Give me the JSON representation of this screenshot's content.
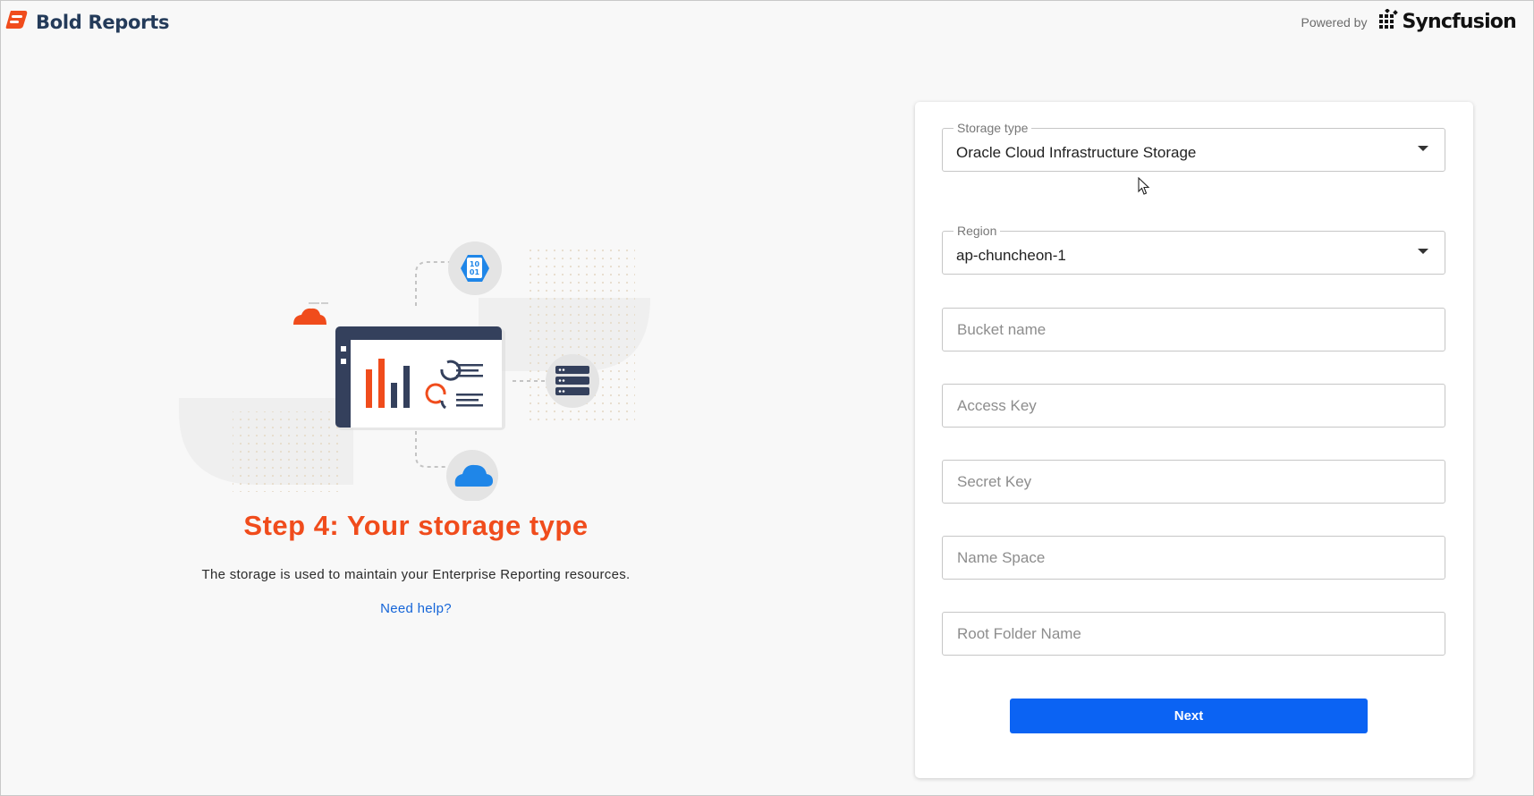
{
  "header": {
    "brand_name": "Bold Reports",
    "brand_color": "#f04c1c",
    "powered_by_label": "Powered by",
    "partner_logo_text": "Syncfusion"
  },
  "intro": {
    "title": "Step 4: Your storage type",
    "description": "The storage is used to maintain your Enterprise Reporting resources.",
    "help_link": "Need help?",
    "illustration_icons": [
      "binary-file-icon",
      "dashboard-window",
      "server-icon",
      "cloud-icon",
      "cloud-small-icon"
    ]
  },
  "form": {
    "storage_type": {
      "label": "Storage type",
      "value": "Oracle Cloud Infrastructure Storage"
    },
    "region": {
      "label": "Region",
      "value": "ap-chuncheon-1"
    },
    "bucket_name": {
      "placeholder": "Bucket name",
      "value": ""
    },
    "access_key": {
      "placeholder": "Access Key",
      "value": ""
    },
    "secret_key": {
      "placeholder": "Secret Key",
      "value": ""
    },
    "name_space": {
      "placeholder": "Name Space",
      "value": ""
    },
    "root_folder": {
      "placeholder": "Root Folder Name",
      "value": ""
    },
    "next_label": "Next"
  },
  "colors": {
    "accent": "#f04c1c",
    "button": "#0b63f3",
    "link": "#1565d8",
    "navy": "#34405c"
  }
}
